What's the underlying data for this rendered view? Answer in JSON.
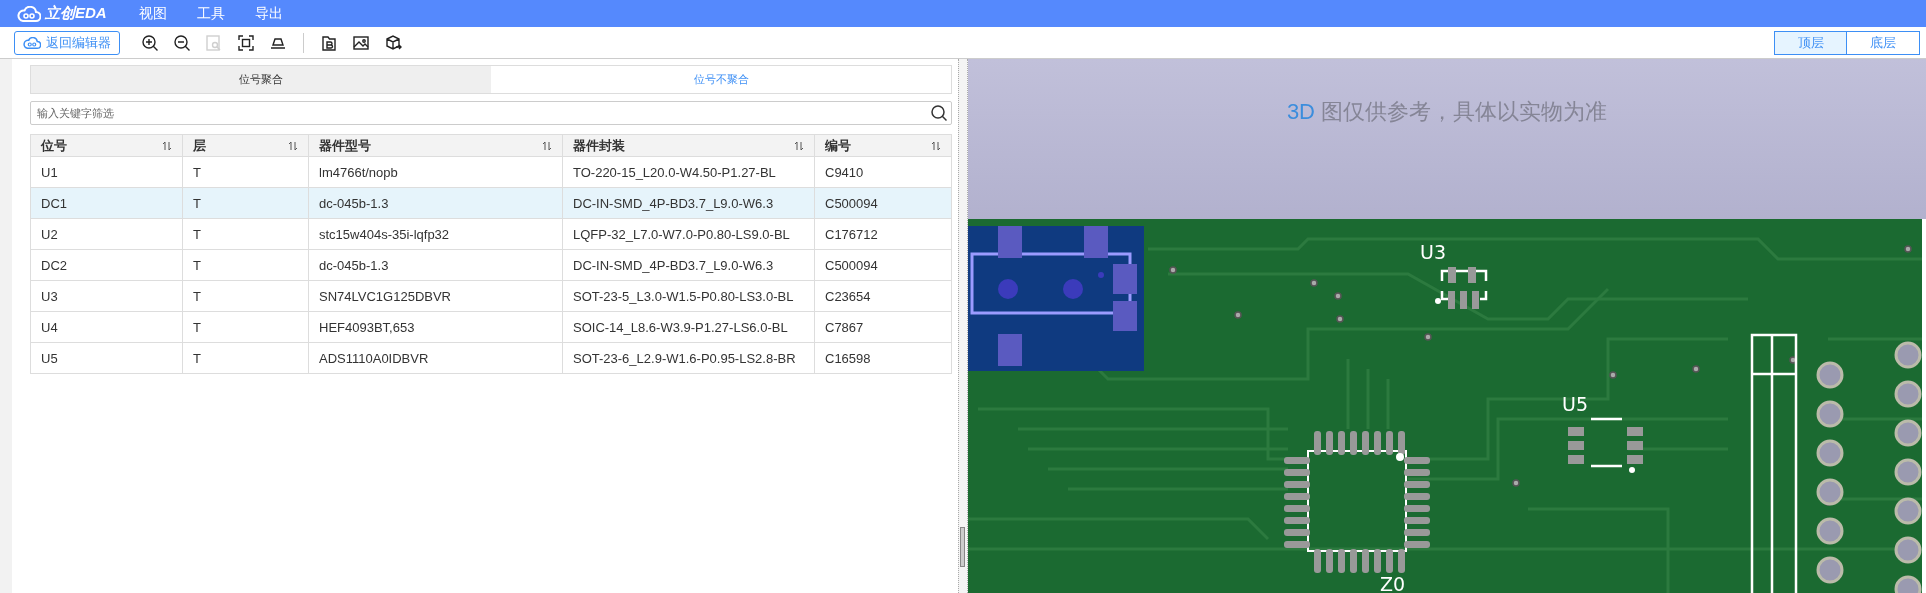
{
  "app": {
    "logo_text": "立创EDA",
    "menu": [
      "视图",
      "工具",
      "导出"
    ]
  },
  "toolbar": {
    "back_button": "返回编辑器",
    "tools": [
      {
        "kind": "zoom-in",
        "disabled": false
      },
      {
        "kind": "zoom-out",
        "disabled": false
      },
      {
        "kind": "zoom-area",
        "disabled": true
      },
      {
        "kind": "fit",
        "disabled": false
      },
      {
        "kind": "flip",
        "disabled": false
      },
      {
        "kind": "document",
        "disabled": false
      },
      {
        "kind": "image",
        "disabled": false
      },
      {
        "kind": "cube",
        "disabled": false
      }
    ],
    "layers": [
      {
        "label": "顶层",
        "selected": true
      },
      {
        "label": "底层",
        "selected": false
      }
    ]
  },
  "left_panel": {
    "tabs": [
      {
        "label": "位号聚合",
        "selected": false
      },
      {
        "label": "位号不聚合",
        "selected": true
      }
    ],
    "search": {
      "placeholder": "输入关键字筛选"
    },
    "table": {
      "columns": [
        "位号",
        "层",
        "器件型号",
        "器件封装",
        "编号"
      ],
      "rows": [
        {
          "cells": [
            "U1",
            "T",
            "lm4766t/nopb",
            "TO-220-15_L20.0-W4.50-P1.27-BL",
            "C9410"
          ],
          "selected": false
        },
        {
          "cells": [
            "DC1",
            "T",
            "dc-045b-1.3",
            "DC-IN-SMD_4P-BD3.7_L9.0-W6.3",
            "C500094"
          ],
          "selected": true
        },
        {
          "cells": [
            "U2",
            "T",
            "stc15w404s-35i-lqfp32",
            "LQFP-32_L7.0-W7.0-P0.80-LS9.0-BL",
            "C176712"
          ],
          "selected": false
        },
        {
          "cells": [
            "DC2",
            "T",
            "dc-045b-1.3",
            "DC-IN-SMD_4P-BD3.7_L9.0-W6.3",
            "C500094"
          ],
          "selected": false
        },
        {
          "cells": [
            "U3",
            "T",
            "SN74LVC1G125DBVR",
            "SOT-23-5_L3.0-W1.5-P0.80-LS3.0-BL",
            "C23654"
          ],
          "selected": false
        },
        {
          "cells": [
            "U4",
            "T",
            "HEF4093BT,653",
            "SOIC-14_L8.6-W3.9-P1.27-LS6.0-BL",
            "C7867"
          ],
          "selected": false
        },
        {
          "cells": [
            "U5",
            "T",
            "ADS1110A0IDBVR",
            "SOT-23-6_L2.9-W1.6-P0.95-LS2.8-BR",
            "C16598"
          ],
          "selected": false
        }
      ]
    }
  },
  "view_3d": {
    "notice_highlight": "3D",
    "notice": "图仅供参考，具体以实物为准",
    "pcb_labels": [
      "U3",
      "U5",
      "Z0"
    ]
  }
}
